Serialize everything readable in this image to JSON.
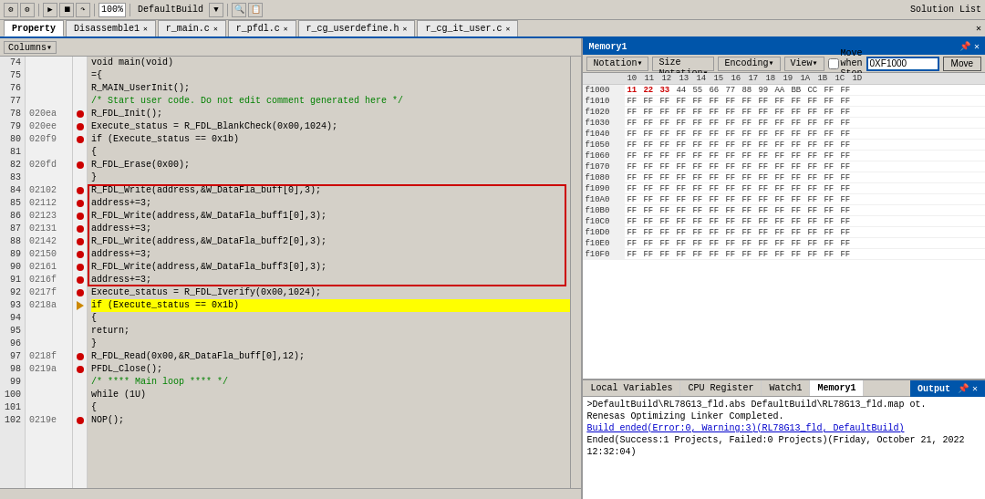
{
  "toolbar": {
    "zoom": "100%",
    "build": "DefaultBuild"
  },
  "tabs": [
    {
      "label": "Property",
      "active": true,
      "closable": false
    },
    {
      "label": "Disassemble1",
      "active": false,
      "closable": true
    },
    {
      "label": "r_main.c",
      "active": false,
      "closable": true
    },
    {
      "label": "r_pfdl.c",
      "active": false,
      "closable": true
    },
    {
      "label": "r_cg_userdefine.h",
      "active": false,
      "closable": true
    },
    {
      "label": "r_cg_it_user.c",
      "active": false,
      "closable": true
    }
  ],
  "code": {
    "columns_label": "Columns▾",
    "lines": [
      {
        "num": "74",
        "addr": "",
        "bp": "",
        "text": "void main(void)"
      },
      {
        "num": "75",
        "addr": "",
        "bp": "",
        "text": "={"
      },
      {
        "num": "76",
        "addr": "",
        "bp": "",
        "text": "        R_MAIN_UserInit();"
      },
      {
        "num": "77",
        "addr": "",
        "bp": "",
        "text": "    /* Start user code. Do not edit comment generated here */"
      },
      {
        "num": "78",
        "addr": "020ea",
        "bp": "dot",
        "text": "        R_FDL_Init();"
      },
      {
        "num": "79",
        "addr": "020ee",
        "bp": "dot",
        "text": "        Execute_status = R_FDL_BlankCheck(0x00,1024);"
      },
      {
        "num": "80",
        "addr": "020f9",
        "bp": "dot",
        "text": "        if (Execute_status == 0x1b)"
      },
      {
        "num": "81",
        "addr": "",
        "bp": "",
        "text": "        {"
      },
      {
        "num": "82",
        "addr": "020fd",
        "bp": "dot",
        "text": "            R_FDL_Erase(0x00);"
      },
      {
        "num": "83",
        "addr": "",
        "bp": "",
        "text": "        }"
      },
      {
        "num": "84",
        "addr": "02102",
        "bp": "dot",
        "text": "        R_FDL_Write(address,&W_DataFla_buff[0],3);",
        "redbox_start": true
      },
      {
        "num": "85",
        "addr": "02112",
        "bp": "dot",
        "text": "        address+=3;"
      },
      {
        "num": "86",
        "addr": "02123",
        "bp": "dot",
        "text": "        R_FDL_Write(address,&W_DataFla_buff1[0],3);"
      },
      {
        "num": "87",
        "addr": "02131",
        "bp": "dot",
        "text": "        address+=3;"
      },
      {
        "num": "88",
        "addr": "02142",
        "bp": "dot",
        "text": "        R_FDL_Write(address,&W_DataFla_buff2[0],3);"
      },
      {
        "num": "89",
        "addr": "02150",
        "bp": "dot",
        "text": "        address+=3;"
      },
      {
        "num": "90",
        "addr": "02161",
        "bp": "dot",
        "text": "        R_FDL_Write(address,&W_DataFla_buff3[0],3);"
      },
      {
        "num": "91",
        "addr": "0216f",
        "bp": "dot",
        "text": "        address+=3;",
        "redbox_end": true
      },
      {
        "num": "92",
        "addr": "0217f",
        "bp": "dot",
        "text": "        Execute_status = R_FDL_Iverify(0x00,1024);"
      },
      {
        "num": "93",
        "addr": "0218a",
        "bp": "arrow",
        "text": "        if (Execute_status == 0x1b)",
        "highlight": true
      },
      {
        "num": "94",
        "addr": "",
        "bp": "",
        "text": "        {"
      },
      {
        "num": "95",
        "addr": "",
        "bp": "",
        "text": "            return;"
      },
      {
        "num": "96",
        "addr": "",
        "bp": "",
        "text": "        }"
      },
      {
        "num": "97",
        "addr": "0218f",
        "bp": "dot",
        "text": "        R_FDL_Read(0x00,&R_DataFla_buff[0],12);"
      },
      {
        "num": "98",
        "addr": "0219a",
        "bp": "dot",
        "text": "        PFDL_Close();"
      },
      {
        "num": "99",
        "addr": "",
        "bp": "",
        "text": "        /* **** Main loop **** */"
      },
      {
        "num": "100",
        "addr": "",
        "bp": "",
        "text": "        while (1U)"
      },
      {
        "num": "101",
        "addr": "",
        "bp": "",
        "text": "        {"
      },
      {
        "num": "102",
        "addr": "0219e",
        "bp": "dot",
        "text": "            NOP();"
      }
    ]
  },
  "memory": {
    "title": "Memory1",
    "notation_label": "Notation▾",
    "size_notation_label": "Size Notation▾",
    "encoding_label": "Encoding▾",
    "view_label": "View▾",
    "move_when_stop_label": "Move when Stop",
    "addr_input": "0XF1000",
    "move_btn": "Move",
    "header_cols": [
      "10",
      "11",
      "12",
      "13",
      "14",
      "15",
      "16",
      "17",
      "18",
      "19",
      "1A",
      "1B",
      "1C",
      "1D"
    ],
    "rows": [
      {
        "addr": "f1000",
        "bytes": [
          "11",
          "22",
          "33",
          "44",
          "55",
          "66",
          "77",
          "88",
          "99",
          "AA",
          "BB",
          "CC",
          "FF",
          "FF"
        ],
        "highlight_count": 3
      },
      {
        "addr": "f1010",
        "bytes": [
          "FF",
          "FF",
          "FF",
          "FF",
          "FF",
          "FF",
          "FF",
          "FF",
          "FF",
          "FF",
          "FF",
          "FF",
          "FF",
          "FF"
        ]
      },
      {
        "addr": "f1020",
        "bytes": [
          "FF",
          "FF",
          "FF",
          "FF",
          "FF",
          "FF",
          "FF",
          "FF",
          "FF",
          "FF",
          "FF",
          "FF",
          "FF",
          "FF"
        ]
      },
      {
        "addr": "f1030",
        "bytes": [
          "FF",
          "FF",
          "FF",
          "FF",
          "FF",
          "FF",
          "FF",
          "FF",
          "FF",
          "FF",
          "FF",
          "FF",
          "FF",
          "FF"
        ]
      },
      {
        "addr": "f1040",
        "bytes": [
          "FF",
          "FF",
          "FF",
          "FF",
          "FF",
          "FF",
          "FF",
          "FF",
          "FF",
          "FF",
          "FF",
          "FF",
          "FF",
          "FF"
        ]
      },
      {
        "addr": "f1050",
        "bytes": [
          "FF",
          "FF",
          "FF",
          "FF",
          "FF",
          "FF",
          "FF",
          "FF",
          "FF",
          "FF",
          "FF",
          "FF",
          "FF",
          "FF"
        ]
      },
      {
        "addr": "f1060",
        "bytes": [
          "FF",
          "FF",
          "FF",
          "FF",
          "FF",
          "FF",
          "FF",
          "FF",
          "FF",
          "FF",
          "FF",
          "FF",
          "FF",
          "FF"
        ]
      },
      {
        "addr": "f1070",
        "bytes": [
          "FF",
          "FF",
          "FF",
          "FF",
          "FF",
          "FF",
          "FF",
          "FF",
          "FF",
          "FF",
          "FF",
          "FF",
          "FF",
          "FF"
        ]
      },
      {
        "addr": "f1080",
        "bytes": [
          "FF",
          "FF",
          "FF",
          "FF",
          "FF",
          "FF",
          "FF",
          "FF",
          "FF",
          "FF",
          "FF",
          "FF",
          "FF",
          "FF"
        ]
      },
      {
        "addr": "f1090",
        "bytes": [
          "FF",
          "FF",
          "FF",
          "FF",
          "FF",
          "FF",
          "FF",
          "FF",
          "FF",
          "FF",
          "FF",
          "FF",
          "FF",
          "FF"
        ]
      },
      {
        "addr": "f10A0",
        "bytes": [
          "FF",
          "FF",
          "FF",
          "FF",
          "FF",
          "FF",
          "FF",
          "FF",
          "FF",
          "FF",
          "FF",
          "FF",
          "FF",
          "FF"
        ]
      },
      {
        "addr": "f10B0",
        "bytes": [
          "FF",
          "FF",
          "FF",
          "FF",
          "FF",
          "FF",
          "FF",
          "FF",
          "FF",
          "FF",
          "FF",
          "FF",
          "FF",
          "FF"
        ]
      },
      {
        "addr": "f10C0",
        "bytes": [
          "FF",
          "FF",
          "FF",
          "FF",
          "FF",
          "FF",
          "FF",
          "FF",
          "FF",
          "FF",
          "FF",
          "FF",
          "FF",
          "FF"
        ]
      },
      {
        "addr": "f10D0",
        "bytes": [
          "FF",
          "FF",
          "FF",
          "FF",
          "FF",
          "FF",
          "FF",
          "FF",
          "FF",
          "FF",
          "FF",
          "FF",
          "FF",
          "FF"
        ]
      },
      {
        "addr": "f10E0",
        "bytes": [
          "FF",
          "FF",
          "FF",
          "FF",
          "FF",
          "FF",
          "FF",
          "FF",
          "FF",
          "FF",
          "FF",
          "FF",
          "FF",
          "FF"
        ]
      },
      {
        "addr": "f10F0",
        "bytes": [
          "FF",
          "FF",
          "FF",
          "FF",
          "FF",
          "FF",
          "FF",
          "FF",
          "FF",
          "FF",
          "FF",
          "FF",
          "FF",
          "FF"
        ]
      }
    ]
  },
  "bottom_tabs": [
    {
      "label": "Local Variables",
      "active": false
    },
    {
      "label": "CPU Register",
      "active": false
    },
    {
      "label": "Watch1",
      "active": false
    },
    {
      "label": "Memory1",
      "active": true
    }
  ],
  "output": {
    "title": "Output",
    "lines": [
      {
        "text": ">DefaultBuild\\RL78G13_fld.abs DefaultBuild\\RL78G13_fld.map ot.",
        "type": "normal"
      },
      {
        "text": "Renesas Optimizing Linker Completed.",
        "type": "normal"
      },
      {
        "text": "Build ended(Error:0, Warning:3)(RL78G13_fld, DefaultBuild)",
        "type": "link",
        "link_text": "Build ended(Error:0, Warning:3)(RL78G13_fld, DefaultBuild)"
      },
      {
        "text": "Ended(Success:1 Projects, Failed:0 Projects)(Friday, October 21, 2022 12:32:04)",
        "type": "normal"
      }
    ]
  }
}
